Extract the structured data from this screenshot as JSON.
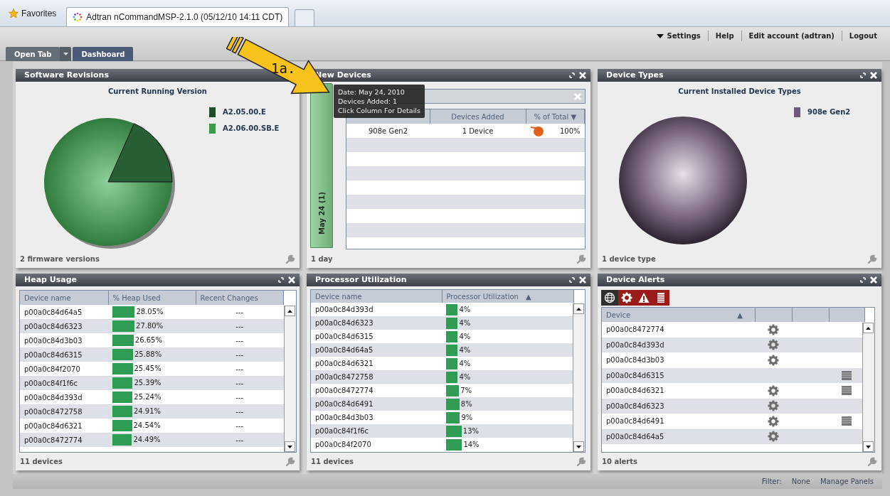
{
  "browser": {
    "favorites": "Favorites",
    "tab_title": "Adtran nCommandMSP-2.1.0 (05/12/10 14:11 CDT)"
  },
  "header_links": [
    {
      "label": "Settings",
      "kind": "menu"
    },
    {
      "label": "Help",
      "kind": "link"
    },
    {
      "label": "Edit account (adtran)",
      "kind": "link"
    },
    {
      "label": "Logout",
      "kind": "link"
    }
  ],
  "tabs": [
    {
      "label": "Open Tab",
      "kind": "dropdown",
      "selected": false
    },
    {
      "label": "Dashboard",
      "kind": "plain",
      "selected": true
    }
  ],
  "annotation": {
    "label": "1a."
  },
  "panels": {
    "software_revisions": {
      "title": "Software Revisions",
      "has_controls": false,
      "subtitle": "Current Running Version",
      "legend": [
        {
          "label": "A2.05.00.E",
          "color": "#1f4d2a"
        },
        {
          "label": "A2.06.00.SB.E",
          "color": "#3a9a4a"
        }
      ],
      "footer": "2 firmware versions"
    },
    "new_devices": {
      "title": "New Devices",
      "has_controls": true,
      "bar_label": "May 24 (1)",
      "tooltip": [
        "Date: May 24, 2010",
        "Devices Added: 1",
        "Click Column For Details"
      ],
      "columns": [
        {
          "label": "Devices Added"
        },
        {
          "label": "% of Total",
          "sort": "▼"
        }
      ],
      "rows": [
        {
          "device_type": "908e Gen2",
          "added": "1 Device",
          "share": "100%"
        }
      ],
      "footer": "1 day"
    },
    "device_types": {
      "title": "Device Types",
      "has_controls": true,
      "subtitle": "Current Installed Device Types",
      "legend": [
        {
          "label": "908e Gen2",
          "color": "#6e5a78"
        }
      ],
      "footer": "1 device type"
    },
    "heap_usage": {
      "title": "Heap Usage",
      "has_controls": true,
      "columns": [
        "Device name",
        "% Heap Used",
        "Recent Changes"
      ],
      "rows": [
        {
          "device": "p00a0c84d64a5",
          "level": 0.2805,
          "percent": "28.05%",
          "changes": "---"
        },
        {
          "device": "p00a0c84d6323",
          "level": 0.278,
          "percent": "27.80%",
          "changes": "---"
        },
        {
          "device": "p00a0c84d3b03",
          "level": 0.2665,
          "percent": "26.65%",
          "changes": "---"
        },
        {
          "device": "p00a0c84d6315",
          "level": 0.2588,
          "percent": "25.88%",
          "changes": "---"
        },
        {
          "device": "p00a0c84f2070",
          "level": 0.2545,
          "percent": "25.45%",
          "changes": "---"
        },
        {
          "device": "p00a0c84f1f6c",
          "level": 0.2539,
          "percent": "25.39%",
          "changes": "---"
        },
        {
          "device": "p00a0c84d393d",
          "level": 0.2524,
          "percent": "25.24%",
          "changes": "---"
        },
        {
          "device": "p00a0c8472758",
          "level": 0.2491,
          "percent": "24.91%",
          "changes": "---"
        },
        {
          "device": "p00a0c84d6321",
          "level": 0.2454,
          "percent": "24.54%",
          "changes": "---"
        },
        {
          "device": "p00a0c8472774",
          "level": 0.2449,
          "percent": "24.49%",
          "changes": "---"
        }
      ],
      "footer": "11 devices"
    },
    "processor_utilization": {
      "title": "Processor Utilization",
      "has_controls": true,
      "columns": [
        {
          "label": "Device name"
        },
        {
          "label": "Processor Utilization",
          "sort": "▲"
        }
      ],
      "rows": [
        {
          "device": "p00a0c84d393d",
          "level": 0.04,
          "percent": "4%"
        },
        {
          "device": "p00a0c84d6323",
          "level": 0.04,
          "percent": "4%"
        },
        {
          "device": "p00a0c84d6315",
          "level": 0.04,
          "percent": "4%"
        },
        {
          "device": "p00a0c84d64a5",
          "level": 0.04,
          "percent": "4%"
        },
        {
          "device": "p00a0c84d6321",
          "level": 0.04,
          "percent": "4%"
        },
        {
          "device": "p00a0c8472758",
          "level": 0.04,
          "percent": "4%"
        },
        {
          "device": "p00a0c8472774",
          "level": 0.07,
          "percent": "7%"
        },
        {
          "device": "p00a0c84d6491",
          "level": 0.08,
          "percent": "8%"
        },
        {
          "device": "p00a0c84d3b03",
          "level": 0.09,
          "percent": "9%"
        },
        {
          "device": "p00a0c84f1f6c",
          "level": 0.13,
          "percent": "13%"
        },
        {
          "device": "p00a0c84f2070",
          "level": 0.14,
          "percent": "14%"
        }
      ],
      "footer": "11 devices"
    },
    "device_alerts": {
      "title": "Device Alerts",
      "has_controls": true,
      "filters": [
        {
          "kind": "globe",
          "selected": true
        },
        {
          "kind": "gear",
          "selected": false
        },
        {
          "kind": "warning",
          "selected": false
        },
        {
          "kind": "chip",
          "selected": false
        }
      ],
      "column": {
        "label": "Device",
        "sort": "▲"
      },
      "rows": [
        {
          "device": "p00a0c8472774",
          "config": true,
          "hardware": false
        },
        {
          "device": "p00a0c84d393d",
          "config": true,
          "hardware": false
        },
        {
          "device": "p00a0c84d3b03",
          "config": true,
          "hardware": false
        },
        {
          "device": "p00a0c84d6315",
          "config": false,
          "hardware": true
        },
        {
          "device": "p00a0c84d6321",
          "config": true,
          "hardware": true
        },
        {
          "device": "p00a0c84d6323",
          "config": true,
          "hardware": false
        },
        {
          "device": "p00a0c84d6491",
          "config": true,
          "hardware": true
        },
        {
          "device": "p00a0c84d64a5",
          "config": true,
          "hardware": false
        }
      ],
      "footer": "10 alerts"
    }
  },
  "footer_bar": {
    "filter_label": "Filter:",
    "filter_value": "None",
    "manage": "Manage Panels"
  }
}
